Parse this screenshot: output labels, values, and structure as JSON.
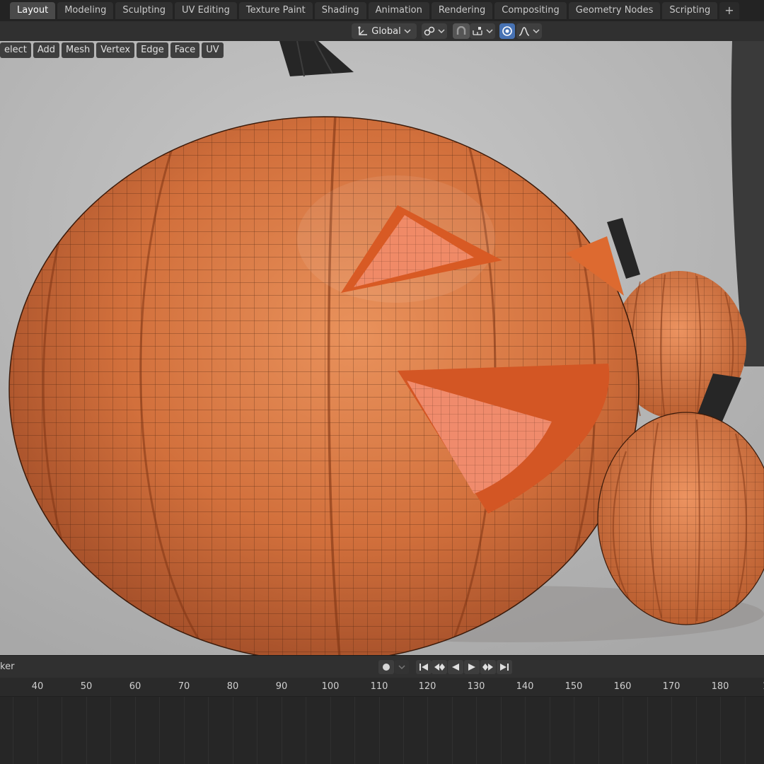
{
  "workspace_tabs": [
    "Layout",
    "Modeling",
    "Sculpting",
    "UV Editing",
    "Texture Paint",
    "Shading",
    "Animation",
    "Rendering",
    "Compositing",
    "Geometry Nodes",
    "Scripting"
  ],
  "add_tab_label": "+",
  "header": {
    "orientation_label": "Global",
    "icons": [
      "transform-orientation-icon",
      "chevron-down-icon",
      "pivot-link-icon",
      "snap-icon",
      "snap-increment-icon",
      "proportional-edit-icon",
      "falloff-curve-icon"
    ]
  },
  "viewport_menu": [
    "elect",
    "Add",
    "Mesh",
    "Vertex",
    "Edge",
    "Face",
    "UV"
  ],
  "timeline": {
    "editor_label": "ker",
    "ruler_ticks": [
      "40",
      "50",
      "60",
      "70",
      "80",
      "90",
      "100",
      "110",
      "120",
      "130",
      "140",
      "150",
      "160",
      "170",
      "180",
      "1"
    ]
  },
  "colors": {
    "accent": "#4772b3",
    "active_tab": "#4a4a4a",
    "pumpkin": "#d9743e",
    "stem": "#262626"
  }
}
